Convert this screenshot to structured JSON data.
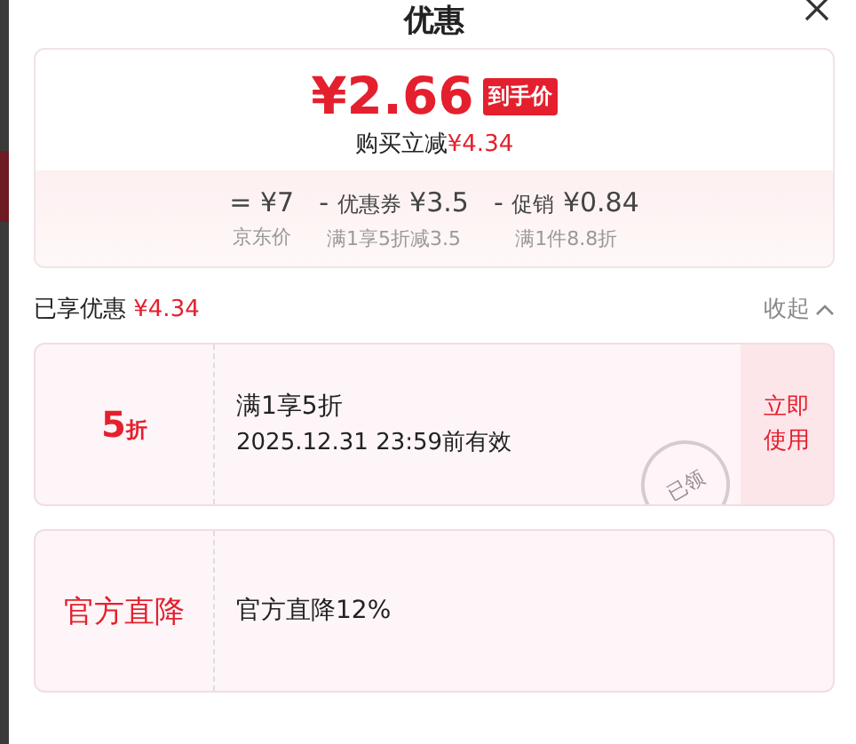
{
  "title": "优惠",
  "summary": {
    "price": "¥2.66",
    "badge": "到手价",
    "saving_label": "购买立减",
    "saving_amount": "¥4.34",
    "breakdown": [
      {
        "sign": "=",
        "amount": "¥7",
        "note": "京东价"
      },
      {
        "sign": "-",
        "name": "优惠券",
        "amount": "¥3.5",
        "note": "满1享5折减3.5"
      },
      {
        "sign": "-",
        "name": "促销",
        "amount": "¥0.84",
        "note": "满1件8.8折"
      }
    ]
  },
  "enjoyed": {
    "label": "已享优惠",
    "amount": "¥4.34",
    "toggle": "收起",
    "expanded": true
  },
  "coupons": [
    {
      "kind": "discount",
      "value": "5",
      "unit": "折",
      "title": "满1享5折",
      "validity": "2025.12.31 23:59前有效",
      "stamp": "已领",
      "action": "立即使用"
    },
    {
      "kind": "label",
      "label": "官方直降",
      "title": "官方直降12%"
    }
  ]
}
